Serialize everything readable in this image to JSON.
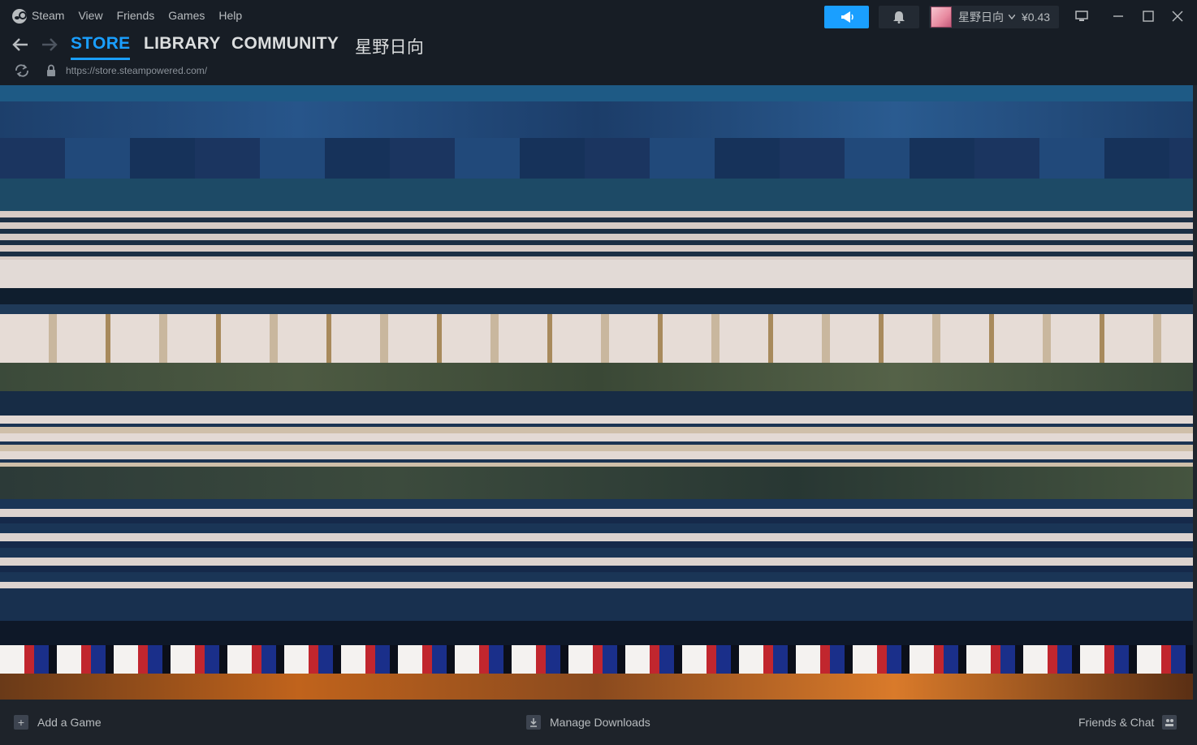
{
  "menu": {
    "items": [
      "Steam",
      "View",
      "Friends",
      "Games",
      "Help"
    ]
  },
  "account": {
    "name": "星野日向",
    "balance": "¥0.43"
  },
  "nav": {
    "tabs": [
      "STORE",
      "LIBRARY",
      "COMMUNITY",
      "星野日向"
    ],
    "active": "STORE"
  },
  "url": "https://store.steampowered.com/",
  "bottom": {
    "add_game": "Add a Game",
    "downloads": "Manage Downloads",
    "friends": "Friends & Chat"
  },
  "colors": {
    "accent": "#1a9fff",
    "background": "#171d25",
    "content_bg": "#1b2838"
  },
  "icons": {
    "logo": "steam-logo-icon",
    "announce": "megaphone-icon",
    "notify": "bell-icon",
    "dropdown": "chevron-down-icon",
    "back": "arrow-left-icon",
    "forward": "arrow-right-icon",
    "reload": "refresh-icon",
    "secure": "lock-icon"
  }
}
